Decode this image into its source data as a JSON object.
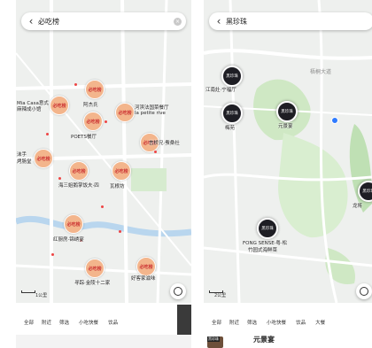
{
  "left": {
    "search_text": "必吃榜",
    "scale": "1公里",
    "pins": [
      "必吃榜",
      "必吃榜",
      "必吃榜",
      "必吃榜",
      "必吃榜",
      "必吃榜",
      "必吃榜",
      "必吃榜",
      "必吃榜",
      "必吃榜",
      "必吃榜"
    ],
    "labels": [
      "Mia Casa意式",
      "麻辣成小馆",
      "阿杰氏",
      "河滨法国菜餐厅",
      "la petite rive",
      "POETS餐厅",
      "言桥兄·蚕桑社",
      "沫手",
      "烤肠堂",
      "海三姐鹅掌饭夫·四",
      "瓦根坊",
      "红厨房·锦绣宴",
      "寻踪·金陵十二家",
      "好客家滋味"
    ],
    "filters": [
      "全部",
      "附近",
      "筛选",
      "小吃快餐",
      "饮品"
    ]
  },
  "right": {
    "search_text": "黑珍珠",
    "scale": "2公里",
    "pins": [
      "黑珍珠",
      "黑珍珠",
      "黑珍珠",
      "黑珍珠",
      "黑珍珠"
    ],
    "labels": [
      "江南灶·宁福厅",
      "梅苑",
      "元景宴",
      "FONG SENSE·粤·松",
      "竹园式海鲜菜",
      "龙将",
      "梧桐大道"
    ],
    "filters": [
      "全部",
      "附近",
      "筛选",
      "小吃快餐",
      "饮品",
      "大餐"
    ],
    "card_badge": "黑珍珠",
    "card_title": "元景宴"
  },
  "colors": {
    "bichi_pin": "#f3b58c",
    "heizhenzhu_pin": "#1e1e24",
    "park_green": "#cfe8c4",
    "water_blue": "#b9d6ee"
  }
}
